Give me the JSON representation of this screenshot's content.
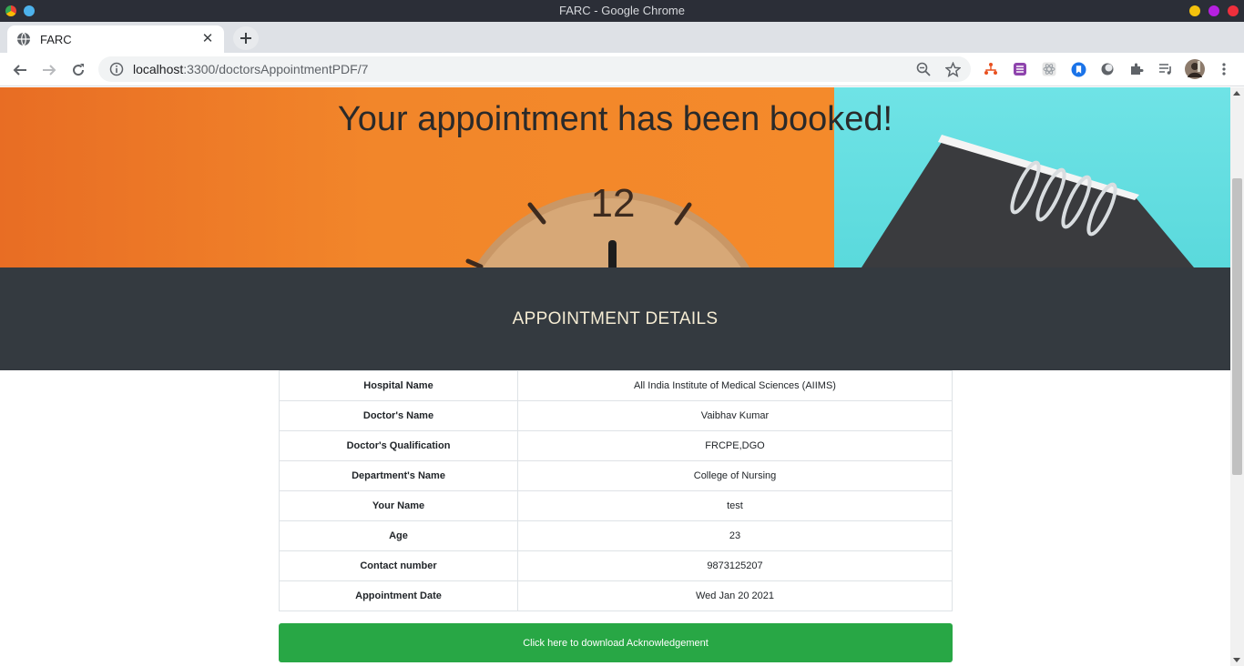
{
  "window": {
    "title": "FARC - Google Chrome"
  },
  "tab": {
    "title": "FARC"
  },
  "address_bar": {
    "host": "localhost",
    "path": ":3300/doctorsAppointmentPDF/7"
  },
  "page": {
    "hero_title": "Your appointment has been booked!",
    "section_title": "APPOINTMENT DETAILS",
    "details": [
      {
        "label": "Hospital Name",
        "value": "All India Institute of Medical Sciences (AIIMS)"
      },
      {
        "label": "Doctor's Name",
        "value": "Vaibhav Kumar"
      },
      {
        "label": "Doctor's Qualification",
        "value": "FRCPE,DGO"
      },
      {
        "label": "Department's Name",
        "value": "College of Nursing"
      },
      {
        "label": "Your Name",
        "value": "test"
      },
      {
        "label": "Age",
        "value": "23"
      },
      {
        "label": "Contact number",
        "value": "9873125207"
      },
      {
        "label": "Appointment Date",
        "value": "Wed Jan 20 2021"
      }
    ],
    "download_button": "Click here to download Acknowledgement"
  },
  "colors": {
    "band": "#343a40",
    "button": "#28a745",
    "hero_orange": "#f2862a",
    "hero_teal": "#5ad9dc"
  }
}
